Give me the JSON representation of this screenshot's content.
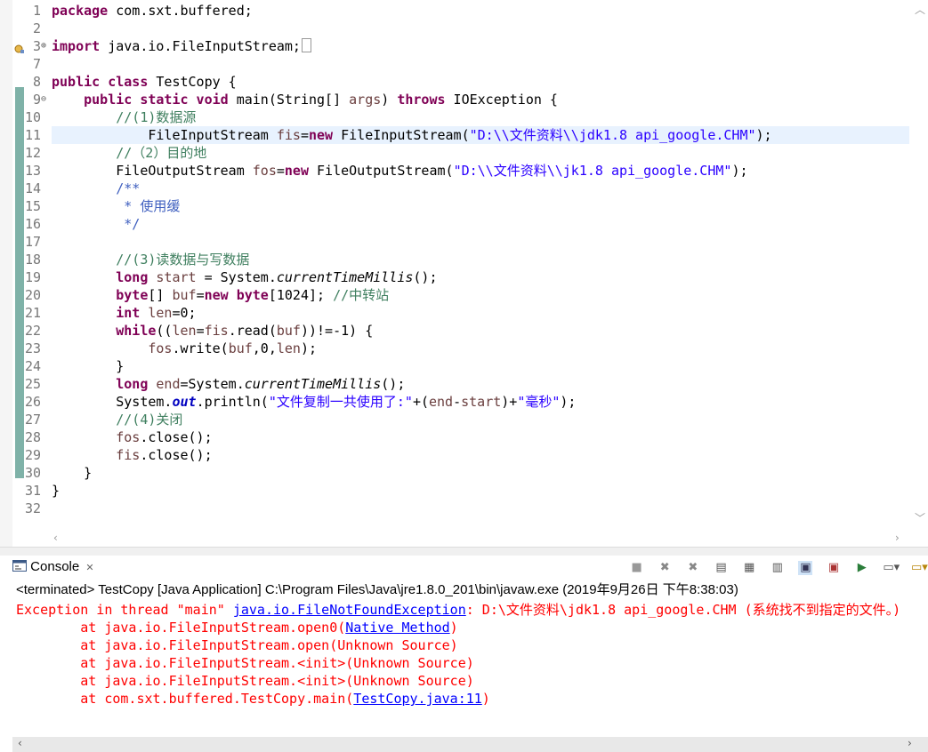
{
  "editor": {
    "lines": [
      {
        "no": "1",
        "tokens": [
          {
            "t": "package",
            "c": "kw"
          },
          {
            "t": " com.sxt.buffered;",
            "c": ""
          }
        ]
      },
      {
        "no": "2",
        "tokens": []
      },
      {
        "no": "3",
        "fold": "⊕",
        "marker": true,
        "tokens": [
          {
            "t": "import",
            "c": "kw"
          },
          {
            "t": " java.io.FileInputStream;",
            "c": ""
          },
          {
            "t": "▯",
            "c": "box"
          }
        ]
      },
      {
        "no": "7",
        "tokens": []
      },
      {
        "no": "8",
        "tokens": [
          {
            "t": "public class",
            "c": "kw"
          },
          {
            "t": " TestCopy {",
            "c": ""
          }
        ]
      },
      {
        "no": "9",
        "fold": "⊖",
        "tokens": [
          {
            "t": "    ",
            "c": ""
          },
          {
            "t": "public static void",
            "c": "kw"
          },
          {
            "t": " main(String[] ",
            "c": ""
          },
          {
            "t": "args",
            "c": "var"
          },
          {
            "t": ") ",
            "c": ""
          },
          {
            "t": "throws",
            "c": "kw"
          },
          {
            "t": " IOException {",
            "c": ""
          }
        ]
      },
      {
        "no": "10",
        "tokens": [
          {
            "t": "        ",
            "c": ""
          },
          {
            "t": "//(1)数据源",
            "c": "cm"
          }
        ]
      },
      {
        "no": "11",
        "highlight": true,
        "tokens": [
          {
            "t": "            FileInputStream ",
            "c": ""
          },
          {
            "t": "fis",
            "c": "var"
          },
          {
            "t": "=",
            "c": ""
          },
          {
            "t": "new",
            "c": "kw"
          },
          {
            "t": " FileInputStream(",
            "c": ""
          },
          {
            "t": "\"D:\\\\文件资料\\\\jdk1.8 api_google.CHM\"",
            "c": "str"
          },
          {
            "t": ");",
            "c": ""
          }
        ]
      },
      {
        "no": "12",
        "tokens": [
          {
            "t": "        ",
            "c": ""
          },
          {
            "t": "//（2）目的地",
            "c": "cm"
          }
        ]
      },
      {
        "no": "13",
        "tokens": [
          {
            "t": "        FileOutputStream ",
            "c": ""
          },
          {
            "t": "fos",
            "c": "var"
          },
          {
            "t": "=",
            "c": ""
          },
          {
            "t": "new",
            "c": "kw"
          },
          {
            "t": " FileOutputStream(",
            "c": ""
          },
          {
            "t": "\"D:\\\\文件资料\\\\jk1.8 api_google.CHM\"",
            "c": "str"
          },
          {
            "t": ");",
            "c": ""
          }
        ]
      },
      {
        "no": "14",
        "tokens": [
          {
            "t": "        ",
            "c": ""
          },
          {
            "t": "/**",
            "c": "jd"
          }
        ]
      },
      {
        "no": "15",
        "tokens": [
          {
            "t": "        ",
            "c": ""
          },
          {
            "t": " * 使用缓",
            "c": "jd"
          }
        ]
      },
      {
        "no": "16",
        "tokens": [
          {
            "t": "        ",
            "c": ""
          },
          {
            "t": " */",
            "c": "jd"
          }
        ]
      },
      {
        "no": "17",
        "tokens": []
      },
      {
        "no": "18",
        "tokens": [
          {
            "t": "        ",
            "c": ""
          },
          {
            "t": "//(3)读数据与写数据",
            "c": "cm"
          }
        ]
      },
      {
        "no": "19",
        "tokens": [
          {
            "t": "        ",
            "c": ""
          },
          {
            "t": "long",
            "c": "kw"
          },
          {
            "t": " ",
            "c": ""
          },
          {
            "t": "start",
            "c": "var"
          },
          {
            "t": " = System.",
            "c": ""
          },
          {
            "t": "currentTimeMillis",
            "c": "it"
          },
          {
            "t": "();",
            "c": ""
          }
        ]
      },
      {
        "no": "20",
        "tokens": [
          {
            "t": "        ",
            "c": ""
          },
          {
            "t": "byte",
            "c": "kw"
          },
          {
            "t": "[] ",
            "c": ""
          },
          {
            "t": "buf",
            "c": "var"
          },
          {
            "t": "=",
            "c": ""
          },
          {
            "t": "new byte",
            "c": "kw"
          },
          {
            "t": "[1024]; ",
            "c": ""
          },
          {
            "t": "//中转站",
            "c": "cm"
          }
        ]
      },
      {
        "no": "21",
        "tokens": [
          {
            "t": "        ",
            "c": ""
          },
          {
            "t": "int",
            "c": "kw"
          },
          {
            "t": " ",
            "c": ""
          },
          {
            "t": "len",
            "c": "var"
          },
          {
            "t": "=0;",
            "c": ""
          }
        ]
      },
      {
        "no": "22",
        "tokens": [
          {
            "t": "        ",
            "c": ""
          },
          {
            "t": "while",
            "c": "kw"
          },
          {
            "t": "((",
            "c": ""
          },
          {
            "t": "len",
            "c": "var"
          },
          {
            "t": "=",
            "c": ""
          },
          {
            "t": "fis",
            "c": "var"
          },
          {
            "t": ".read(",
            "c": ""
          },
          {
            "t": "buf",
            "c": "var"
          },
          {
            "t": "))!=-1) {",
            "c": ""
          }
        ]
      },
      {
        "no": "23",
        "tokens": [
          {
            "t": "            ",
            "c": ""
          },
          {
            "t": "fos",
            "c": "var"
          },
          {
            "t": ".write(",
            "c": ""
          },
          {
            "t": "buf",
            "c": "var"
          },
          {
            "t": ",0,",
            "c": ""
          },
          {
            "t": "len",
            "c": "var"
          },
          {
            "t": ");",
            "c": ""
          }
        ]
      },
      {
        "no": "24",
        "tokens": [
          {
            "t": "        }",
            "c": ""
          }
        ]
      },
      {
        "no": "25",
        "tokens": [
          {
            "t": "        ",
            "c": ""
          },
          {
            "t": "long",
            "c": "kw"
          },
          {
            "t": " ",
            "c": ""
          },
          {
            "t": "end",
            "c": "var"
          },
          {
            "t": "=System.",
            "c": ""
          },
          {
            "t": "currentTimeMillis",
            "c": "it"
          },
          {
            "t": "();",
            "c": ""
          }
        ]
      },
      {
        "no": "26",
        "tokens": [
          {
            "t": "        System.",
            "c": ""
          },
          {
            "t": "out",
            "c": "fld"
          },
          {
            "t": ".println(",
            "c": ""
          },
          {
            "t": "\"文件复制一共使用了:\"",
            "c": "str"
          },
          {
            "t": "+(",
            "c": ""
          },
          {
            "t": "end",
            "c": "var"
          },
          {
            "t": "-",
            "c": ""
          },
          {
            "t": "start",
            "c": "var"
          },
          {
            "t": ")+",
            "c": ""
          },
          {
            "t": "\"毫秒\"",
            "c": "str"
          },
          {
            "t": ");",
            "c": ""
          }
        ]
      },
      {
        "no": "27",
        "tokens": [
          {
            "t": "        ",
            "c": ""
          },
          {
            "t": "//(4)关闭",
            "c": "cm"
          }
        ]
      },
      {
        "no": "28",
        "tokens": [
          {
            "t": "        ",
            "c": ""
          },
          {
            "t": "fos",
            "c": "var"
          },
          {
            "t": ".close();",
            "c": ""
          }
        ]
      },
      {
        "no": "29",
        "tokens": [
          {
            "t": "        ",
            "c": ""
          },
          {
            "t": "fis",
            "c": "var"
          },
          {
            "t": ".close();",
            "c": ""
          }
        ]
      },
      {
        "no": "30",
        "tokens": [
          {
            "t": "    }",
            "c": ""
          }
        ]
      },
      {
        "no": "31",
        "tokens": [
          {
            "t": "}",
            "c": ""
          }
        ]
      },
      {
        "no": "32",
        "tokens": []
      }
    ]
  },
  "console": {
    "tab_label": "Console",
    "tab_close": "✕",
    "status": "<terminated> TestCopy [Java Application] C:\\Program Files\\Java\\jre1.8.0_201\\bin\\javaw.exe (2019年9月26日 下午8:38:03)",
    "exception": {
      "prefix": "Exception in thread \"main\" ",
      "link": "java.io.FileNotFoundException",
      "message": ": D:\\文件资料\\jdk1.8 api_google.CHM (系统找不到指定的文件。)"
    },
    "stack": [
      {
        "pre": "        at java.io.FileInputStream.open0(",
        "link": "Native Method",
        "post": ")"
      },
      {
        "pre": "        at java.io.FileInputStream.open(Unknown Source)",
        "link": "",
        "post": ""
      },
      {
        "pre": "        at java.io.FileInputStream.<init>(Unknown Source)",
        "link": "",
        "post": ""
      },
      {
        "pre": "        at java.io.FileInputStream.<init>(Unknown Source)",
        "link": "",
        "post": ""
      },
      {
        "pre": "        at com.sxt.buffered.TestCopy.main(",
        "link": "TestCopy.java:11",
        "post": ")"
      }
    ],
    "toolbar_icons": [
      "terminate-icon",
      "remove-launch-icon",
      "remove-all-icon",
      "clear-console-icon",
      "scroll-lock-icon",
      "word-wrap-icon",
      "show-on-stdout-icon",
      "show-on-stderr-icon",
      "pin-console-icon",
      "display-console-icon",
      "open-console-icon"
    ]
  },
  "colors": {
    "keyword": "#7f0055",
    "string": "#2a00ff",
    "comment": "#3f7f5f",
    "javadoc": "#3f5fbf",
    "local_var": "#6a3e3e",
    "error": "#ff0000",
    "link": "#0000ff",
    "change_bar": "#7fb2a8",
    "highlight": "#e8f2fe"
  }
}
